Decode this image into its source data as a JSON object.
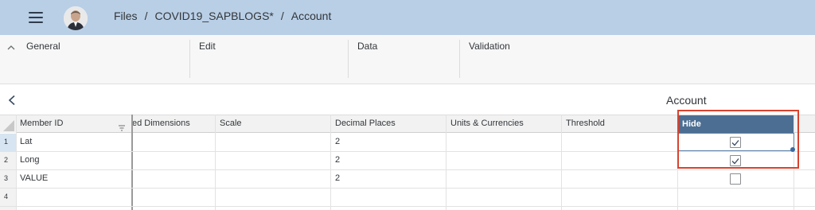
{
  "header": {
    "breadcrumb": [
      "Files",
      "COVID19_SAPBLOGS*",
      "Account"
    ],
    "separator": "/"
  },
  "toolbar": {
    "groups": [
      {
        "title": "General",
        "icons": [
          "save-icon",
          "wrench-icon",
          "share-icon",
          "undo-icon",
          "redo-icon"
        ]
      },
      {
        "title": "Edit",
        "icons": [
          "add-icon",
          "copy-icon",
          "delete-icon",
          "dropdown-icon",
          "hierarchy-icon"
        ]
      },
      {
        "title": "Data",
        "icons": [
          "formula-icon",
          "lock-icon",
          "edit-icon"
        ]
      },
      {
        "title": "Validation",
        "status_count": "0"
      }
    ]
  },
  "subheader": {
    "title": "Account"
  },
  "table": {
    "columns": [
      "Member ID",
      "ed Dimensions",
      "Scale",
      "Decimal Places",
      "Units & Currencies",
      "Threshold",
      "Hide"
    ],
    "rows": [
      {
        "num": "1",
        "member_id": "Lat",
        "decimal_places": "2",
        "hide": true
      },
      {
        "num": "2",
        "member_id": "Long",
        "decimal_places": "2",
        "hide": true
      },
      {
        "num": "3",
        "member_id": "VALUE",
        "decimal_places": "2",
        "hide": false
      },
      {
        "num": "4",
        "member_id": "",
        "decimal_places": "",
        "hide": false
      }
    ]
  },
  "colors": {
    "topbar": "#b9cfe6",
    "hide_header": "#4c6e92",
    "highlight_box": "#d9432e"
  }
}
